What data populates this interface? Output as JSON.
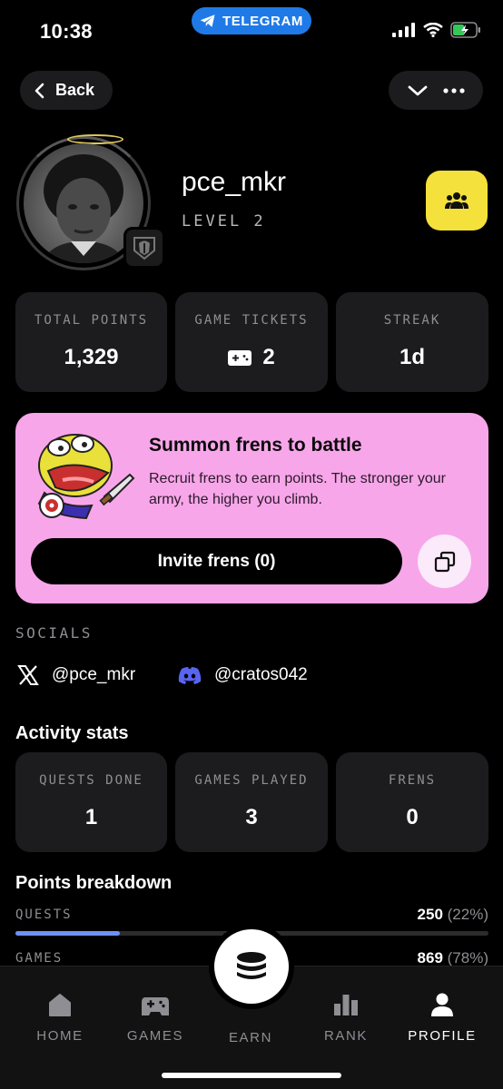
{
  "status_bar": {
    "time": "10:38",
    "telegram_label": "TELEGRAM"
  },
  "nav": {
    "back_label": "Back"
  },
  "profile": {
    "username": "pce_mkr",
    "level": "LEVEL 2"
  },
  "stats": [
    {
      "label": "TOTAL POINTS",
      "value": "1,329"
    },
    {
      "label": "GAME TICKETS",
      "value": "2",
      "icon": "ticket-icon"
    },
    {
      "label": "STREAK",
      "value": "1d"
    }
  ],
  "invite": {
    "title": "Summon frens to battle",
    "description": "Recruit frens to earn points. The stronger your army, the higher you climb.",
    "button_label": "Invite frens (0)"
  },
  "socials": {
    "section_label": "SOCIALS",
    "x_handle": "@pce_mkr",
    "discord_handle": "@cratos042"
  },
  "activity": {
    "heading": "Activity stats",
    "cards": [
      {
        "label": "QUESTS DONE",
        "value": "1"
      },
      {
        "label": "GAMES PLAYED",
        "value": "3"
      },
      {
        "label": "FRENS",
        "value": "0"
      }
    ]
  },
  "points_breakdown": {
    "heading": "Points breakdown",
    "rows": [
      {
        "label": "QUESTS",
        "value": "250",
        "percent": "(22%)",
        "fraction": 0.22
      },
      {
        "label": "GAMES",
        "value": "869",
        "percent": "(78%)",
        "fraction": 0.78
      }
    ]
  },
  "tabbar": {
    "tabs": [
      {
        "label": "HOME",
        "icon": "home-icon"
      },
      {
        "label": "GAMES",
        "icon": "gamepad-icon"
      },
      {
        "label": "EARN",
        "icon": "coin-stack-icon"
      },
      {
        "label": "RANK",
        "icon": "bar-chart-icon"
      },
      {
        "label": "PROFILE",
        "icon": "user-icon",
        "active": true
      }
    ]
  },
  "colors": {
    "accent_yellow": "#f5e13b",
    "invite_pink": "#f8a6ea",
    "telegram_blue": "#1f7ae8",
    "progress_blue": "#6f8ff5",
    "battery_green": "#34c759",
    "discord_blurple": "#5865f2"
  }
}
